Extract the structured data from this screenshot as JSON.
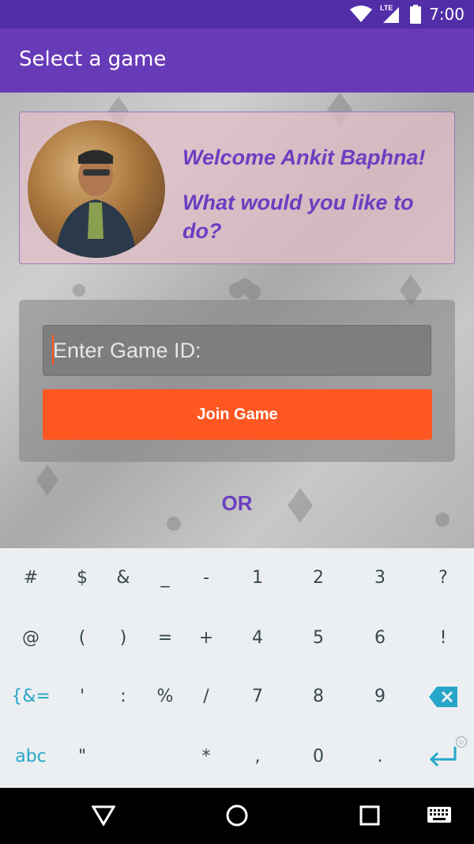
{
  "status_bar": {
    "network_label": "LTE",
    "time": "7:00"
  },
  "app_bar": {
    "title": "Select a game"
  },
  "welcome": {
    "line1": "Welcome Ankit Baphna!",
    "line2": "What would you like to do?"
  },
  "join": {
    "input_placeholder": "Enter Game ID:",
    "input_value": "",
    "button_label": "Join Game"
  },
  "separator": "OR",
  "keyboard": {
    "accent_color": "#26A6C9",
    "rows": [
      [
        "#",
        "$",
        "&",
        "_",
        "-",
        "1",
        "2",
        "3",
        "?"
      ],
      [
        "@",
        "(",
        ")",
        "=",
        "+",
        "4",
        "5",
        "6",
        "!"
      ],
      [
        "{&=",
        "'",
        ":",
        "%",
        "/",
        "7",
        "8",
        "9",
        "backspace-icon"
      ],
      [
        "abc",
        "\"",
        "*",
        ",",
        "0",
        ".",
        "enter-icon"
      ]
    ]
  },
  "nav_bar": {
    "buttons": [
      "back-icon",
      "home-icon",
      "recents-icon",
      "keyboard-switch-icon"
    ]
  },
  "colors": {
    "primary_dark": "#512DA8",
    "primary": "#673AB7",
    "accent": "#FF5722",
    "welcome_text": "#6a3fc0"
  }
}
